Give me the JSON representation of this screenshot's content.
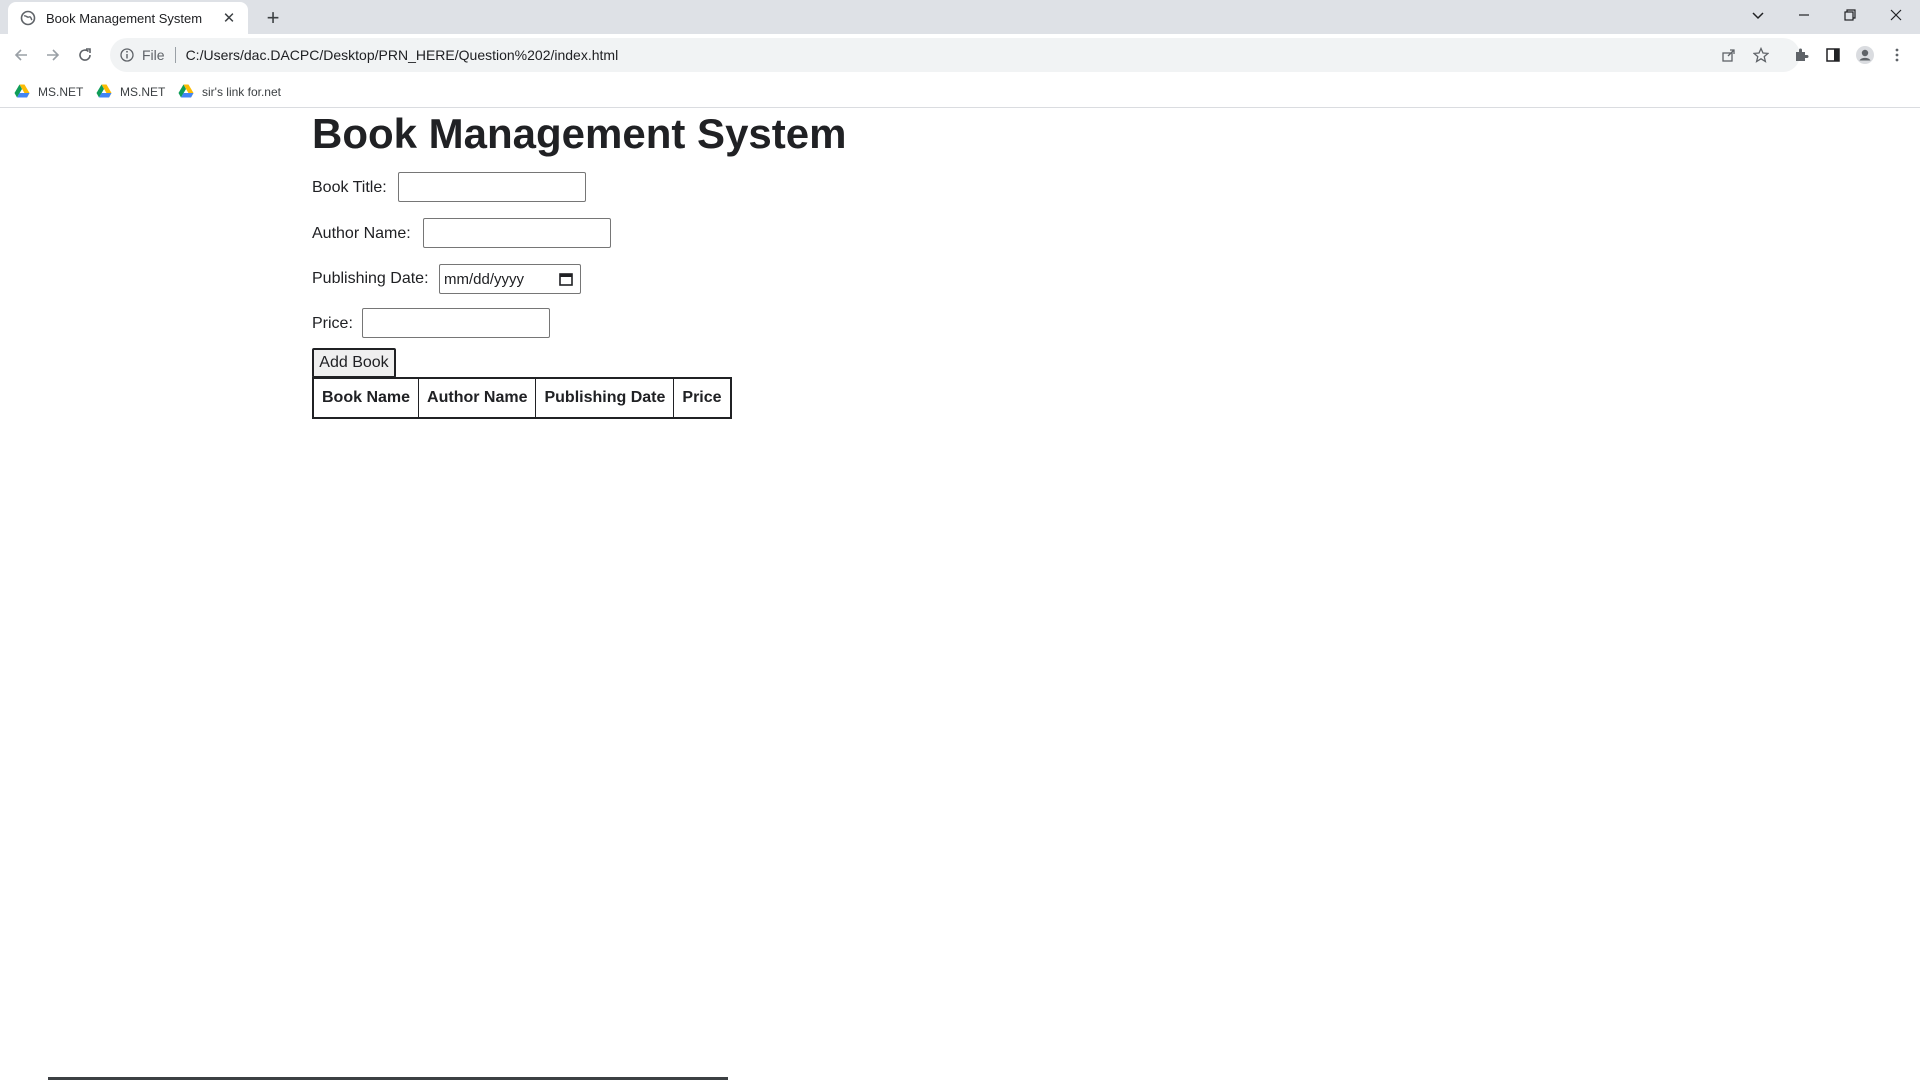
{
  "browser": {
    "tab_title": "Book Management System",
    "file_label": "File",
    "url": "C:/Users/dac.DACPC/Desktop/PRN_HERE/Question%202/index.html",
    "bookmarks": [
      {
        "label": "MS.NET",
        "icon": "google-drive-icon"
      },
      {
        "label": "MS.NET",
        "icon": "google-drive-icon"
      },
      {
        "label": "sir's link for.net",
        "icon": "google-drive-icon"
      }
    ]
  },
  "page": {
    "title": "Book Management System",
    "form": {
      "book_title_label": "Book Title:",
      "book_title_value": "",
      "author_name_label": "Author Name:",
      "author_name_value": "",
      "publishing_date_label": "Publishing Date:",
      "publishing_date_placeholder": "mm/dd/yyyy",
      "price_label": "Price:",
      "price_value": "",
      "add_button": "Add Book"
    },
    "table": {
      "headers": [
        "Book Name",
        "Author Name",
        "Publishing Date",
        "Price"
      ],
      "rows": []
    }
  },
  "colors": {
    "tabstrip_bg": "#dee1e6",
    "omnibox_bg": "#f1f3f4",
    "text": "#202124"
  }
}
